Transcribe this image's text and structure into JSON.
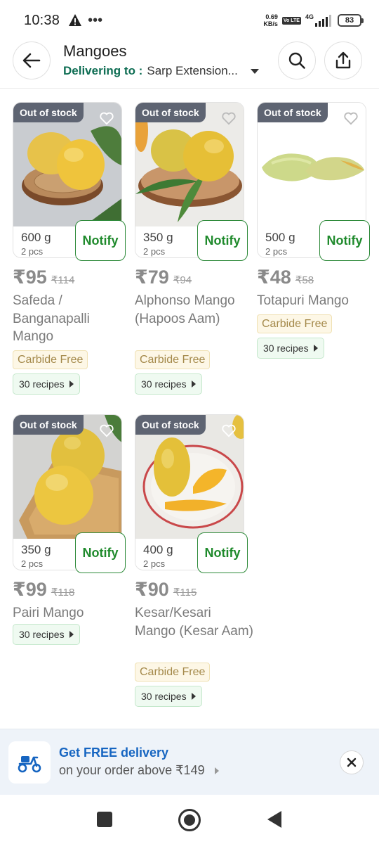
{
  "status_bar": {
    "time": "10:38",
    "net_speed_value": "0.69",
    "net_speed_unit": "KB/s",
    "volte": "Vo LTE",
    "network_type": "4G",
    "battery": "83"
  },
  "header": {
    "title": "Mangoes",
    "delivering_label": "Delivering to :",
    "address": "Sarp Extension..."
  },
  "products": [
    {
      "stock_badge": "Out of stock",
      "weight": "600 g",
      "pcs": "2 pcs",
      "notify_label": "Notify",
      "price": "₹95",
      "mrp": "₹114",
      "name": "Safeda / Banganapalli Mango",
      "carbide_free": "Carbide Free",
      "recipes": "30 recipes"
    },
    {
      "stock_badge": "Out of stock",
      "weight": "350 g",
      "pcs": "2 pcs",
      "notify_label": "Notify",
      "price": "₹79",
      "mrp": "₹94",
      "name": "Alphonso Mango (Hapoos Aam)",
      "carbide_free": "Carbide Free",
      "recipes": "30 recipes"
    },
    {
      "stock_badge": "Out of stock",
      "weight": "500 g",
      "pcs": "2 pcs",
      "notify_label": "Notify",
      "price": "₹48",
      "mrp": "₹58",
      "name": "Totapuri Mango",
      "carbide_free": "Carbide Free",
      "recipes": "30 recipes"
    },
    {
      "stock_badge": "Out of stock",
      "weight": "350 g",
      "pcs": "2 pcs",
      "notify_label": "Notify",
      "price": "₹99",
      "mrp": "₹118",
      "name": "Pairi Mango",
      "recipes": "30 recipes"
    },
    {
      "stock_badge": "Out of stock",
      "weight": "400 g",
      "pcs": "2 pcs",
      "notify_label": "Notify",
      "price": "₹90",
      "mrp": "₹115",
      "name": "Kesar/Kesari Mango (Kesar Aam)",
      "carbide_free": "Carbide Free",
      "recipes": "30 recipes"
    }
  ],
  "banner": {
    "title": "Get FREE delivery",
    "subtitle": "on your order above ₹149"
  },
  "colors": {
    "delivering_green": "#0f6e54",
    "notify_green": "#1f8a2c",
    "banner_blue": "#1665c1",
    "out_of_stock_badge": "#5e6472"
  },
  "icons": [
    "back-arrow-icon",
    "search-icon",
    "share-icon",
    "heart-icon",
    "scooter-icon",
    "close-icon",
    "warning-icon"
  ]
}
